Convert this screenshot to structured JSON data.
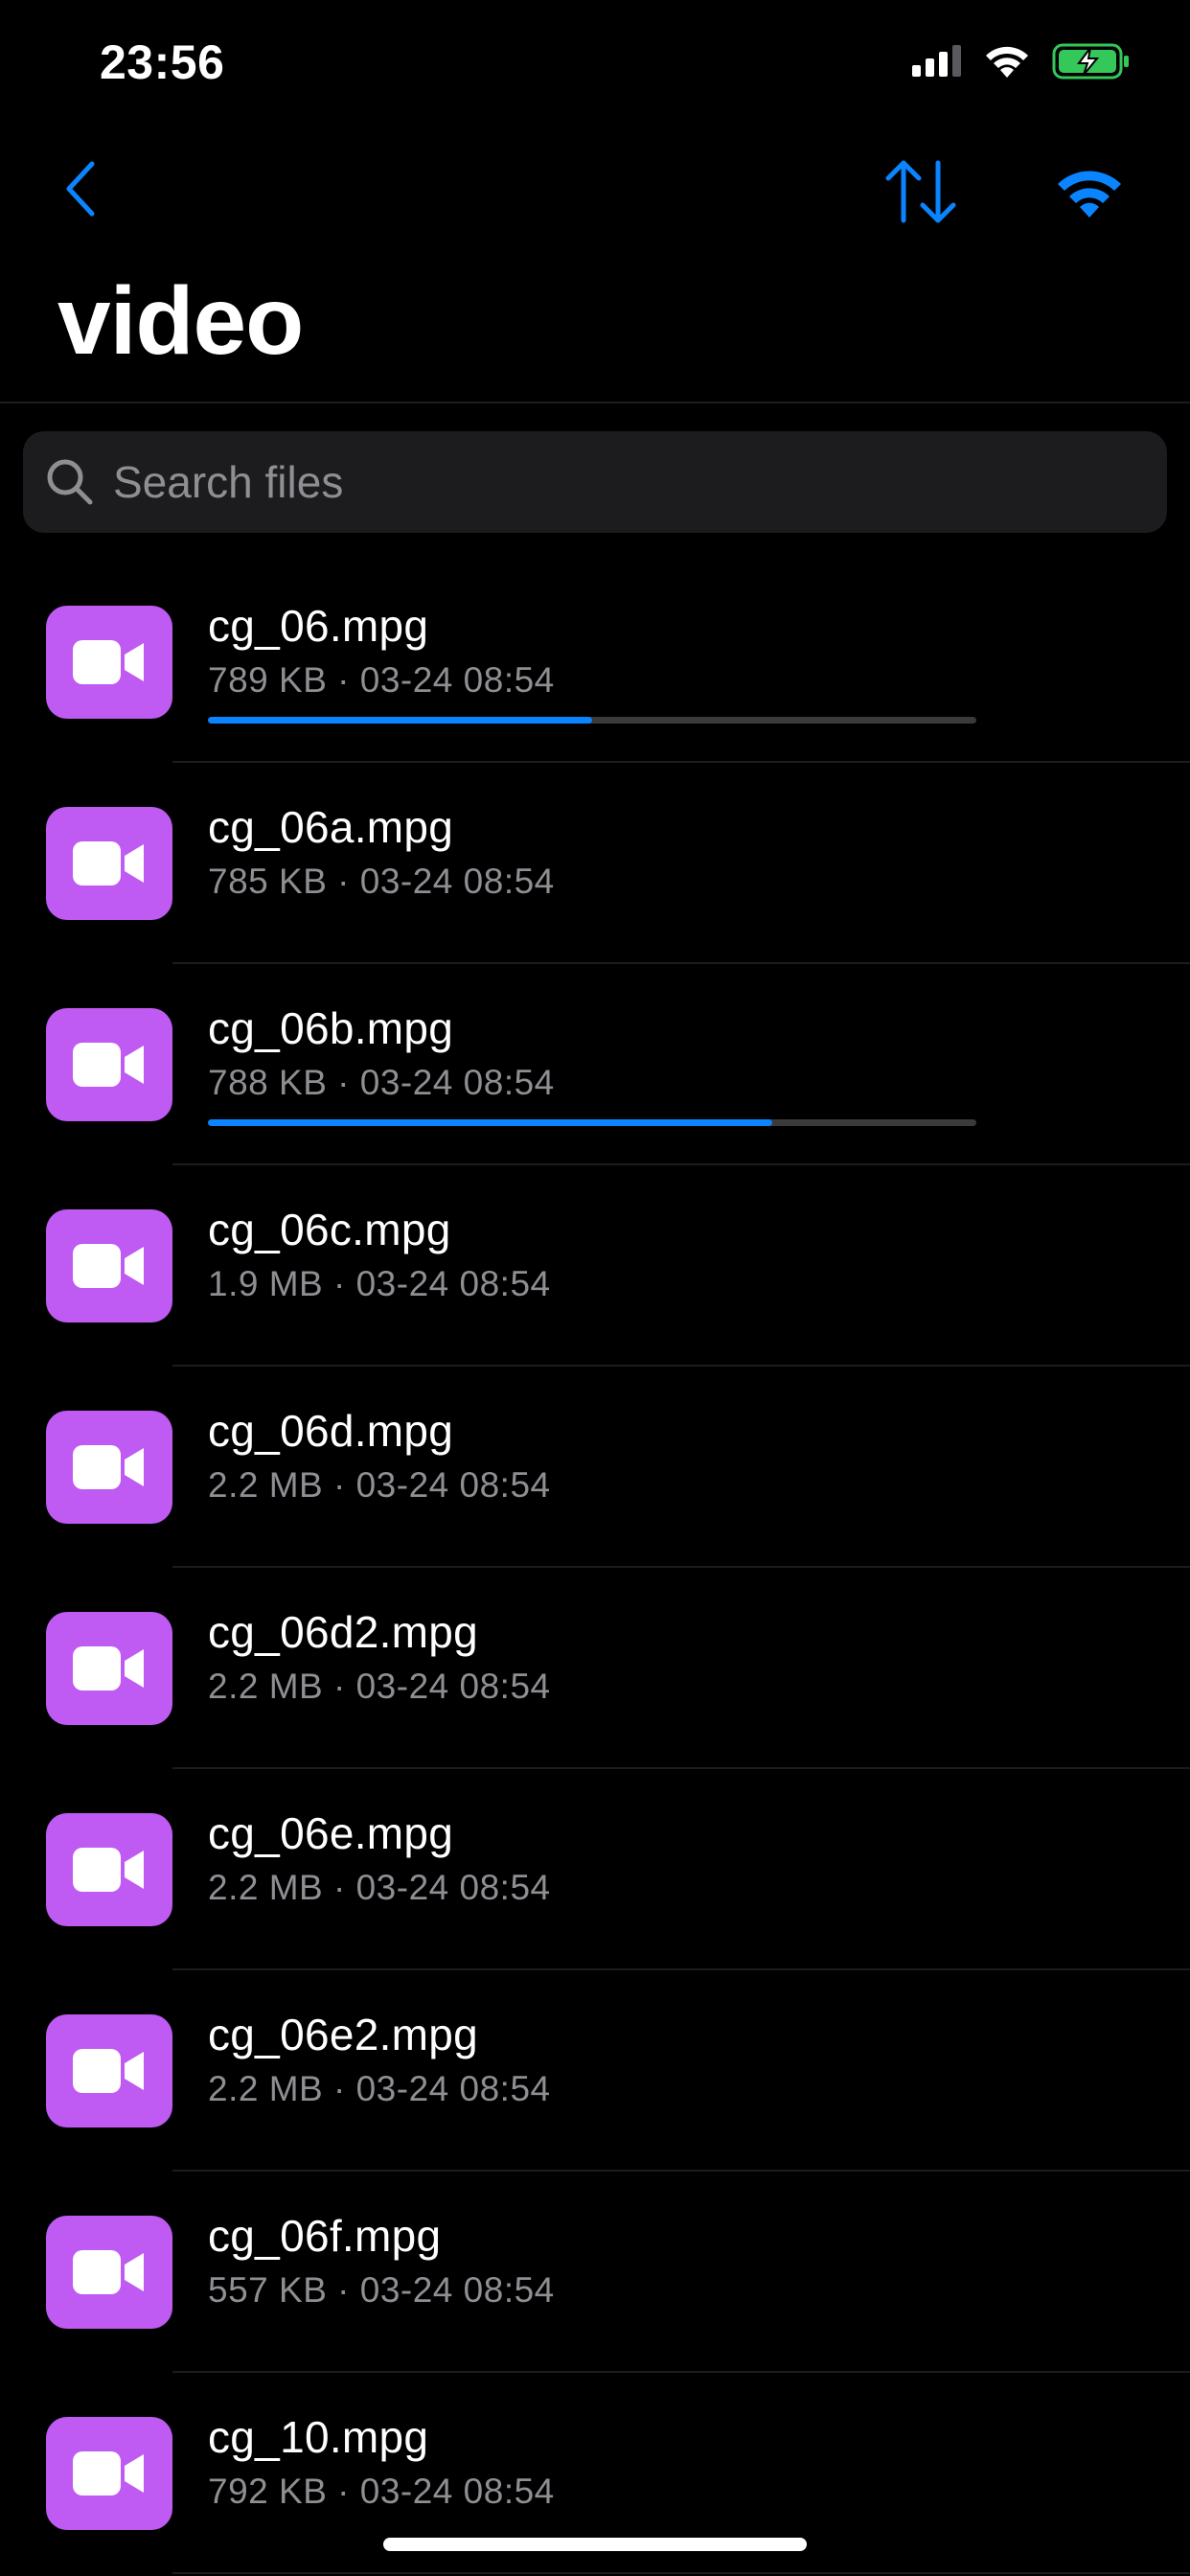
{
  "status_bar": {
    "time": "23:56",
    "icons": [
      "cellular-signal-icon",
      "wifi-icon",
      "battery-charging-icon"
    ]
  },
  "nav": {
    "back_icon": "chevron-left-icon",
    "sort_icon": "sort-arrows-icon",
    "wifi_transfer_icon": "wifi-icon"
  },
  "page": {
    "title": "video"
  },
  "search": {
    "placeholder": "Search files",
    "value": ""
  },
  "colors": {
    "accent": "#0a84ff",
    "thumb": "#bf5af2",
    "battery": "#34c759"
  },
  "files": [
    {
      "name": "cg_06.mpg",
      "meta": "789 KB · 03-24 08:54",
      "progress": 0.5
    },
    {
      "name": "cg_06a.mpg",
      "meta": "785 KB · 03-24 08:54",
      "progress": null
    },
    {
      "name": "cg_06b.mpg",
      "meta": "788 KB · 03-24 08:54",
      "progress": 0.735
    },
    {
      "name": "cg_06c.mpg",
      "meta": "1.9 MB · 03-24 08:54",
      "progress": null
    },
    {
      "name": "cg_06d.mpg",
      "meta": "2.2 MB · 03-24 08:54",
      "progress": null
    },
    {
      "name": "cg_06d2.mpg",
      "meta": "2.2 MB · 03-24 08:54",
      "progress": null
    },
    {
      "name": "cg_06e.mpg",
      "meta": "2.2 MB · 03-24 08:54",
      "progress": null
    },
    {
      "name": "cg_06e2.mpg",
      "meta": "2.2 MB · 03-24 08:54",
      "progress": null
    },
    {
      "name": "cg_06f.mpg",
      "meta": "557 KB · 03-24 08:54",
      "progress": null
    },
    {
      "name": "cg_10.mpg",
      "meta": "792 KB · 03-24 08:54",
      "progress": null
    }
  ]
}
